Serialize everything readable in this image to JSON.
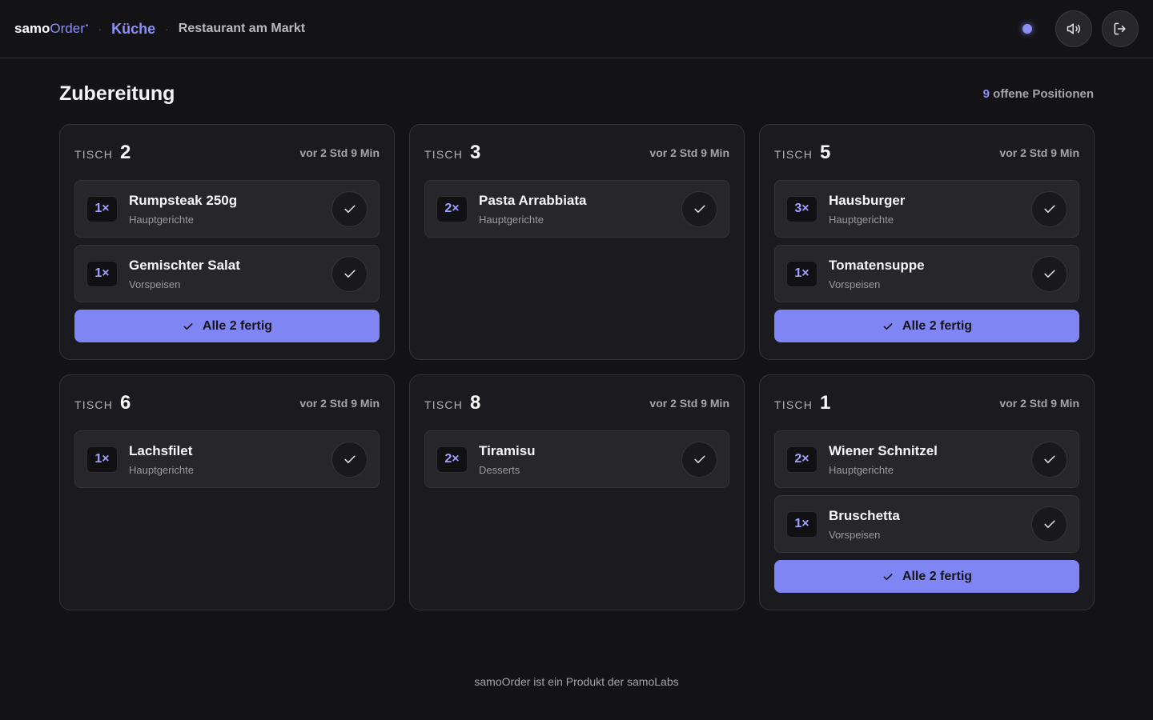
{
  "header": {
    "logo_bold": "samo",
    "logo_rest": "Order",
    "logo_dot": "•",
    "section": "Küche",
    "restaurant": "Restaurant am Markt",
    "separator": "·"
  },
  "main": {
    "title": "Zubereitung",
    "open_count": "9",
    "open_label": " offene Positionen",
    "tables": [
      {
        "label": "TISCH",
        "number": "2",
        "time": "vor 2 Std 9 Min",
        "items": [
          {
            "qty": "1×",
            "name": "Rumpsteak 250g",
            "category": "Hauptgerichte"
          },
          {
            "qty": "1×",
            "name": "Gemischter Salat",
            "category": "Vorspeisen"
          }
        ],
        "all_button": "Alle 2 fertig"
      },
      {
        "label": "TISCH",
        "number": "3",
        "time": "vor 2 Std 9 Min",
        "items": [
          {
            "qty": "2×",
            "name": "Pasta Arrabbiata",
            "category": "Hauptgerichte"
          }
        ],
        "all_button": ""
      },
      {
        "label": "TISCH",
        "number": "5",
        "time": "vor 2 Std 9 Min",
        "items": [
          {
            "qty": "3×",
            "name": "Hausburger",
            "category": "Hauptgerichte"
          },
          {
            "qty": "1×",
            "name": "Tomatensuppe",
            "category": "Vorspeisen"
          }
        ],
        "all_button": "Alle 2 fertig"
      },
      {
        "label": "TISCH",
        "number": "6",
        "time": "vor 2 Std 9 Min",
        "items": [
          {
            "qty": "1×",
            "name": "Lachsfilet",
            "category": "Hauptgerichte"
          }
        ],
        "all_button": ""
      },
      {
        "label": "TISCH",
        "number": "8",
        "time": "vor 2 Std 9 Min",
        "items": [
          {
            "qty": "2×",
            "name": "Tiramisu",
            "category": "Desserts"
          }
        ],
        "all_button": ""
      },
      {
        "label": "TISCH",
        "number": "1",
        "time": "vor 2 Std 9 Min",
        "items": [
          {
            "qty": "2×",
            "name": "Wiener Schnitzel",
            "category": "Hauptgerichte"
          },
          {
            "qty": "1×",
            "name": "Bruschetta",
            "category": "Vorspeisen"
          }
        ],
        "all_button": "Alle 2 fertig"
      }
    ]
  },
  "footer": {
    "text": "samoOrder ist ein Produkt der samoLabs"
  },
  "icons": {
    "status": "status-dot-icon",
    "sound": "speaker-icon",
    "logout": "logout-icon",
    "check": "check-icon"
  },
  "colors": {
    "accent": "#8085f4",
    "background": "#131316",
    "card": "#1b1b1f"
  }
}
